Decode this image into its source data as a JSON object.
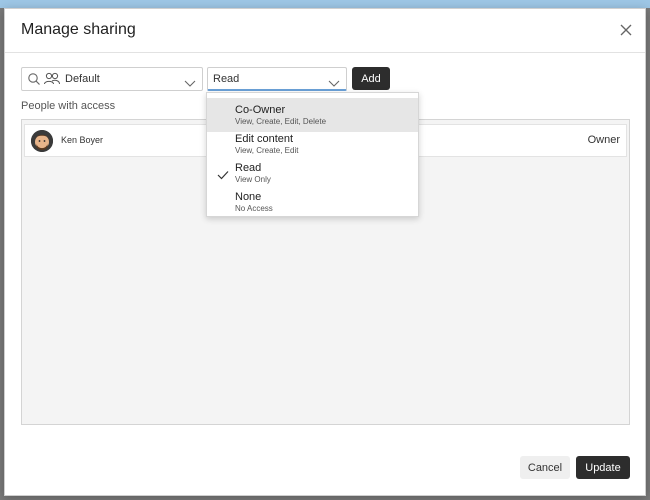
{
  "dialog": {
    "title": "Manage sharing",
    "close_icon": "close-icon"
  },
  "share_controls": {
    "group_value": "Default",
    "group_icons": [
      "search-icon",
      "people-icon"
    ],
    "permission_value": "Read",
    "add_label": "Add"
  },
  "people_section": {
    "label": "People with access",
    "people": [
      {
        "name": "Ken Boyer",
        "role": "Owner",
        "avatar_icon": "avatar"
      }
    ]
  },
  "permission_menu": {
    "items": [
      {
        "label": "Co-Owner",
        "description": "View, Create, Edit, Delete",
        "highlighted": true,
        "checked": false
      },
      {
        "label": "Edit content",
        "description": "View, Create, Edit",
        "highlighted": false,
        "checked": false
      },
      {
        "label": "Read",
        "description": "View Only",
        "highlighted": false,
        "checked": true
      },
      {
        "label": "None",
        "description": "No Access",
        "highlighted": false,
        "checked": false
      }
    ]
  },
  "footer": {
    "cancel_label": "Cancel",
    "update_label": "Update"
  },
  "colors": {
    "primary_button": "#2d2d2d",
    "focus_underline": "#6aa0d8",
    "menu_hover": "#e6e6e6",
    "panel_background": "#f4f4f4"
  }
}
